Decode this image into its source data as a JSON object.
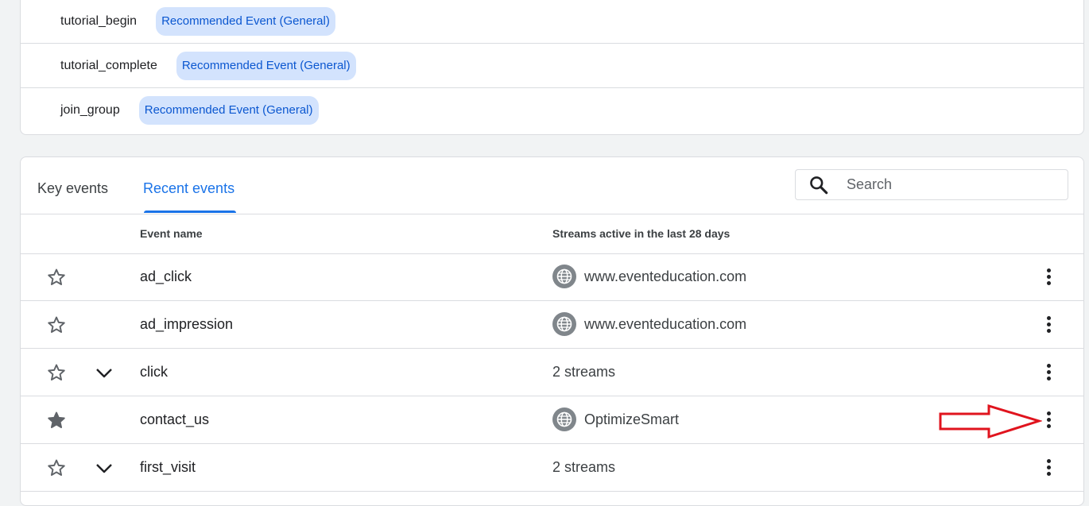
{
  "recommended_events": [
    {
      "name": "tutorial_begin",
      "chip": "Recommended Event (General)"
    },
    {
      "name": "tutorial_complete",
      "chip": "Recommended Event (General)"
    },
    {
      "name": "join_group",
      "chip": "Recommended Event (General)"
    }
  ],
  "tabs": {
    "key_events": "Key events",
    "recent_events": "Recent events",
    "active": "recent_events"
  },
  "search": {
    "placeholder": "Search",
    "value": ""
  },
  "table": {
    "headers": {
      "event_name": "Event name",
      "streams": "Streams active in the last 28 days"
    },
    "rows": [
      {
        "name": "ad_click",
        "streams": "www.eventeducation.com",
        "starred": false,
        "expandable": false,
        "icon": "globe-icon"
      },
      {
        "name": "ad_impression",
        "streams": "www.eventeducation.com",
        "starred": false,
        "expandable": false,
        "icon": "globe-icon"
      },
      {
        "name": "click",
        "streams": "2 streams",
        "starred": false,
        "expandable": true,
        "icon": ""
      },
      {
        "name": "contact_us",
        "streams": "OptimizeSmart",
        "starred": true,
        "expandable": false,
        "icon": "globe-icon"
      },
      {
        "name": "first_visit",
        "streams": "2 streams",
        "starred": false,
        "expandable": true,
        "icon": ""
      }
    ]
  },
  "colors": {
    "accent": "#1a73e8",
    "chip_bg": "#d3e3fd",
    "chip_text": "#0b57d0",
    "annotation": "#e0141e"
  }
}
